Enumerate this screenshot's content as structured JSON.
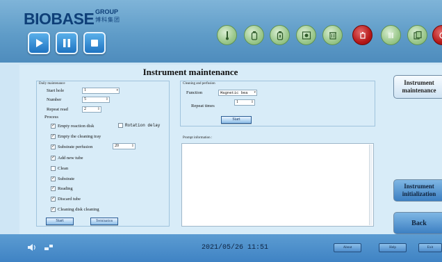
{
  "logo": {
    "brand": "BIOBASE",
    "group": "GROUP",
    "cn": "博科集团"
  },
  "page_title": "Instrument maintenance",
  "daily": {
    "title": "Daily maintenance",
    "start_hole_label": "Start hole",
    "start_hole_value": "1",
    "number_label": "Number",
    "number_value": "5",
    "repeat_read_label": "Repeat read",
    "repeat_read_value": "2",
    "process_label": "Process",
    "rotation_delay_label": "Rotation delay",
    "items": [
      {
        "label": "Empty reaction disk",
        "checked": true
      },
      {
        "label": "Empty the cleaning tray",
        "checked": true
      },
      {
        "label": "Substrate perfusion",
        "checked": true,
        "value": "20"
      },
      {
        "label": "Add new tube",
        "checked": true
      },
      {
        "label": "Clean",
        "checked": false
      },
      {
        "label": "Substrate",
        "checked": true
      },
      {
        "label": "Reading",
        "checked": true
      },
      {
        "label": "Discard tube",
        "checked": true
      },
      {
        "label": "Cleaning disk cleaning",
        "checked": true
      }
    ],
    "start_button": "Start",
    "terminate_button": "Termination"
  },
  "cleaning": {
    "title": "Cleaning and perfusion",
    "function_label": "Function",
    "function_value": "Magnetic bea",
    "repeat_times_label": "Repeat times",
    "repeat_times_value": "1",
    "start_button": "Start"
  },
  "prompt": {
    "label": "Prompt information :"
  },
  "side": {
    "maintenance_line1": "Instrument",
    "maintenance_line2": "maintenance",
    "init_line1": "Instrument",
    "init_line2": "initialization",
    "back": "Back"
  },
  "status": {
    "datetime": "2021/05/26 11:51",
    "about": "About",
    "help": "Help",
    "exit": "Exit"
  },
  "colors": {
    "header": "#5f9cc8",
    "tool_green": "#9fca90",
    "tool_red": "#b61818",
    "panel": "#d8ecf8"
  }
}
